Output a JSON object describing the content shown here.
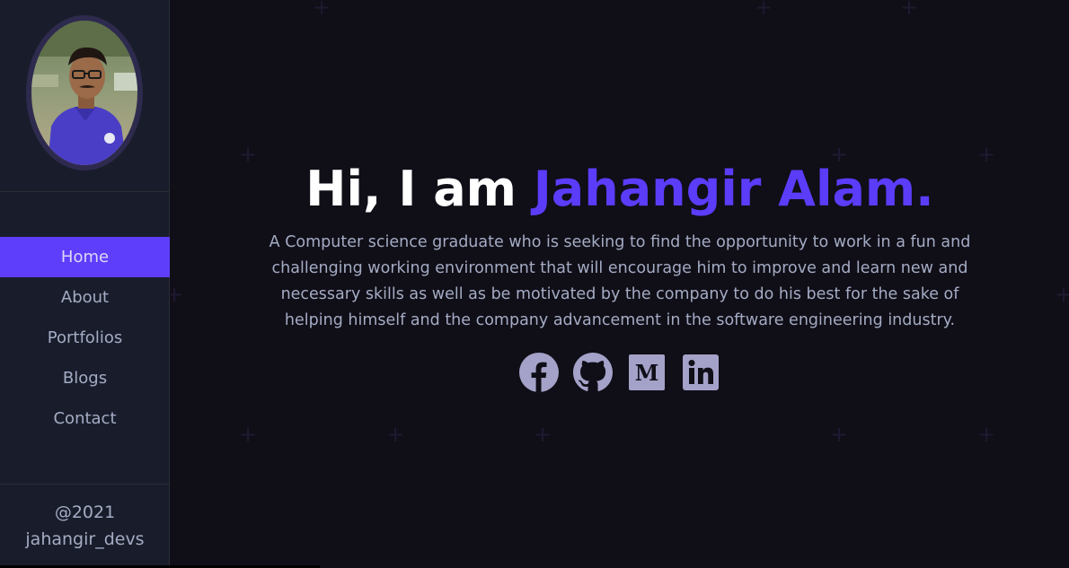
{
  "sidebar": {
    "avatar_alt": "Profile photo",
    "nav": [
      {
        "label": "Home",
        "active": true
      },
      {
        "label": "About",
        "active": false
      },
      {
        "label": "Portfolios",
        "active": false
      },
      {
        "label": "Blogs",
        "active": false
      },
      {
        "label": "Contact",
        "active": false
      }
    ],
    "footer": {
      "year": "@2021",
      "handle": "jahangir_devs"
    }
  },
  "hero": {
    "greeting": "Hi, I am ",
    "name": "Jahangir Alam.",
    "description": "A Computer science graduate who is seeking to find the opportunity to work in a fun and challenging working environment that will encourage him to improve and learn new and necessary skills as well as be motivated by the company to do his best for the sake of helping himself and the company advancement in the software engineering industry."
  },
  "socials": [
    {
      "icon": "facebook-icon"
    },
    {
      "icon": "github-icon"
    },
    {
      "icon": "medium-icon"
    },
    {
      "icon": "linkedin-icon"
    }
  ],
  "colors": {
    "accent": "#5b3cf8",
    "sidebar_bg": "#191d2b",
    "main_bg": "#100e17",
    "text": "#a4acc4",
    "icon": "#a4a2c8"
  }
}
